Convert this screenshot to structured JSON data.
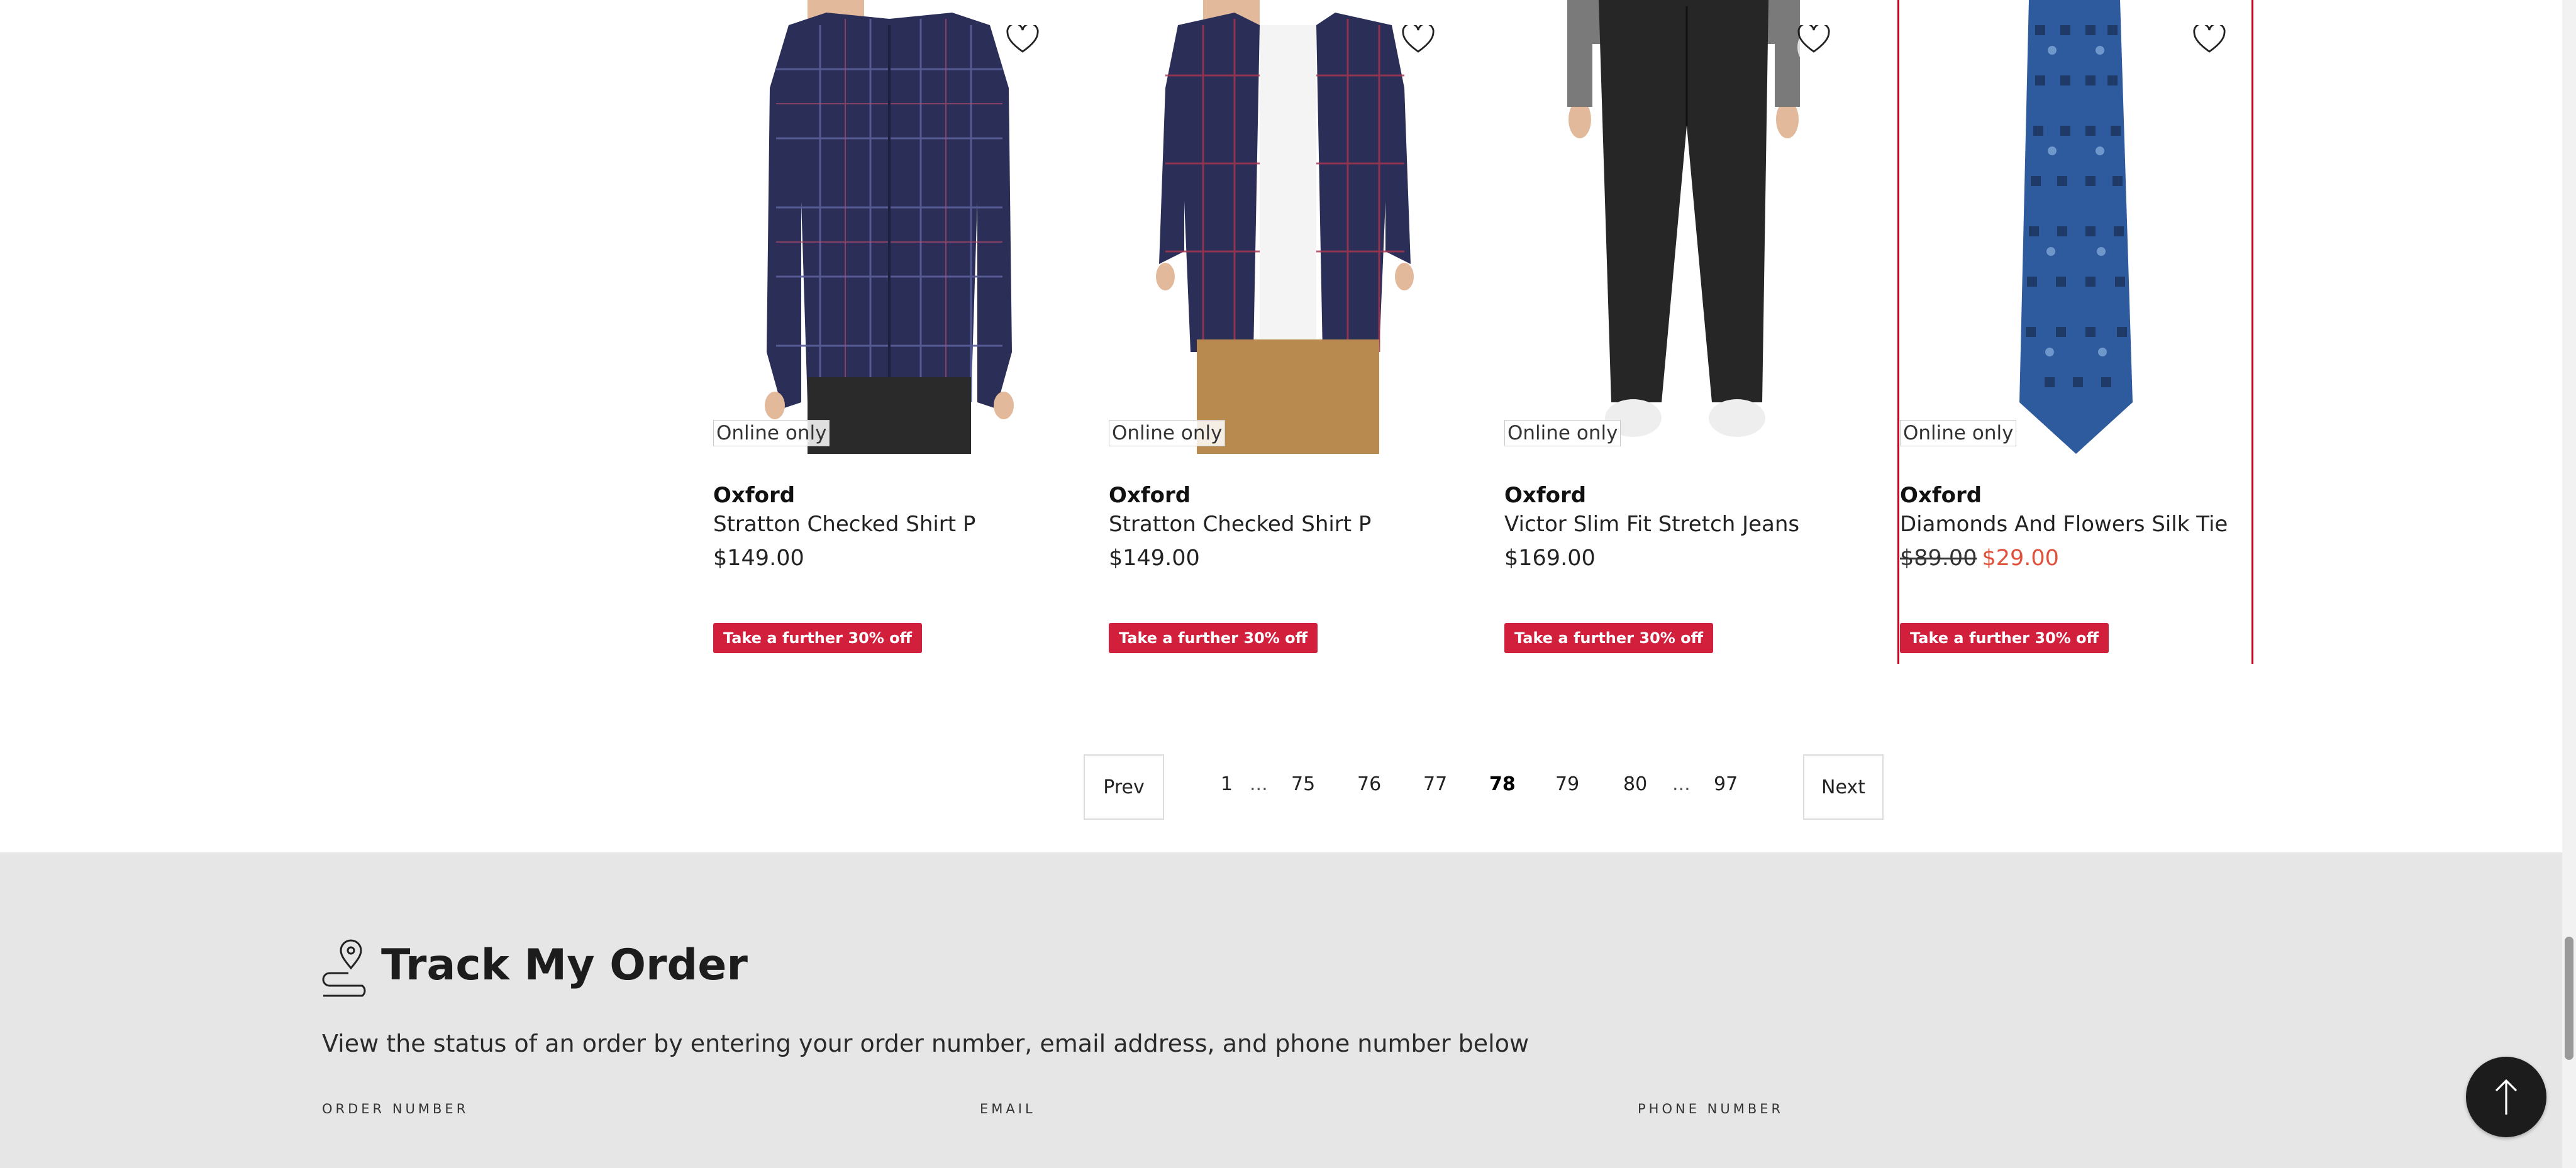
{
  "products": [
    {
      "badge": "Online only",
      "brand": "Oxford",
      "name": "Stratton Checked Shirt P",
      "price": "$149.00",
      "promo": "Take a further 30% off",
      "image": "navy-check-shirt-buttoned"
    },
    {
      "badge": "Online only",
      "brand": "Oxford",
      "name": "Stratton Checked Shirt P",
      "price": "$149.00",
      "promo": "Take a further 30% off",
      "image": "navy-check-shirt-open-tan-chinos"
    },
    {
      "badge": "Online only",
      "brand": "Oxford",
      "name": "Victor Slim Fit Stretch Jeans",
      "price": "$169.00",
      "promo": "Take a further 30% off",
      "image": "black-slim-jeans"
    },
    {
      "badge": "Online only",
      "brand": "Oxford",
      "name": "Diamonds And Flowers Silk Tie",
      "price_was": "$89.00",
      "price_now": "$29.00",
      "promo": "Take a further 30% off",
      "image": "blue-patterned-silk-tie"
    }
  ],
  "pagination": {
    "prev": "Prev",
    "next": "Next",
    "pages": [
      "1",
      "75",
      "76",
      "77",
      "78",
      "79",
      "80",
      "97"
    ],
    "ellipsis": "...",
    "current": "78"
  },
  "track": {
    "title": "Track My Order",
    "description": "View the status of an order by entering your order number, email address, and phone number below",
    "fields": [
      "ORDER NUMBER",
      "EMAIL",
      "PHONE NUMBER"
    ]
  },
  "colors": {
    "promo_bg": "#d21f3c",
    "sale_price": "#e0513d",
    "selected_outline": "#d0021b",
    "footer_bg": "#e6e6e6"
  },
  "icons": [
    "heart-icon",
    "map-pin-route-icon",
    "arrow-up-icon"
  ]
}
